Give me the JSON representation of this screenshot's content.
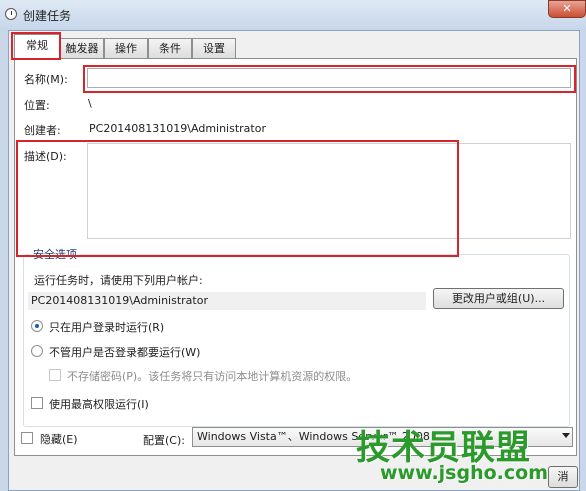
{
  "window": {
    "title": "创建任务",
    "close_label": "✕"
  },
  "tabs": [
    {
      "label": "常规",
      "active": true
    },
    {
      "label": "触发器"
    },
    {
      "label": "操作"
    },
    {
      "label": "条件"
    },
    {
      "label": "设置"
    }
  ],
  "general": {
    "name_label": "名称(M):",
    "name_value": "",
    "location_label": "位置:",
    "location_value": "\\",
    "author_label": "创建者:",
    "author_value": "PC201408131019\\Administrator",
    "description_label": "描述(D):",
    "description_value": ""
  },
  "security": {
    "group_title": "安全选项",
    "run_as_prompt": "运行任务时，请使用下列用户帐户:",
    "account": "PC201408131019\\Administrator",
    "change_user_button": "更改用户或组(U)...",
    "radio_logged_on": "只在用户登录时运行(R)",
    "radio_whether": "不管用户是否登录都要运行(W)",
    "no_store_password": "不存储密码(P)。该任务将只有访问本地计算机资源的权限。",
    "highest_privileges": "使用最高权限运行(I)"
  },
  "footer": {
    "hidden_label": "隐藏(E)",
    "config_label": "配置(C):",
    "config_value": "Windows Vista™、Windows Server™ 2008",
    "cancel_fragment": "消"
  },
  "watermark": {
    "brand": "技术员联盟",
    "url": "www.jsgho.com"
  },
  "colors": {
    "annotation_red": "#d6242c",
    "watermark_green": "#2a9a2a"
  }
}
